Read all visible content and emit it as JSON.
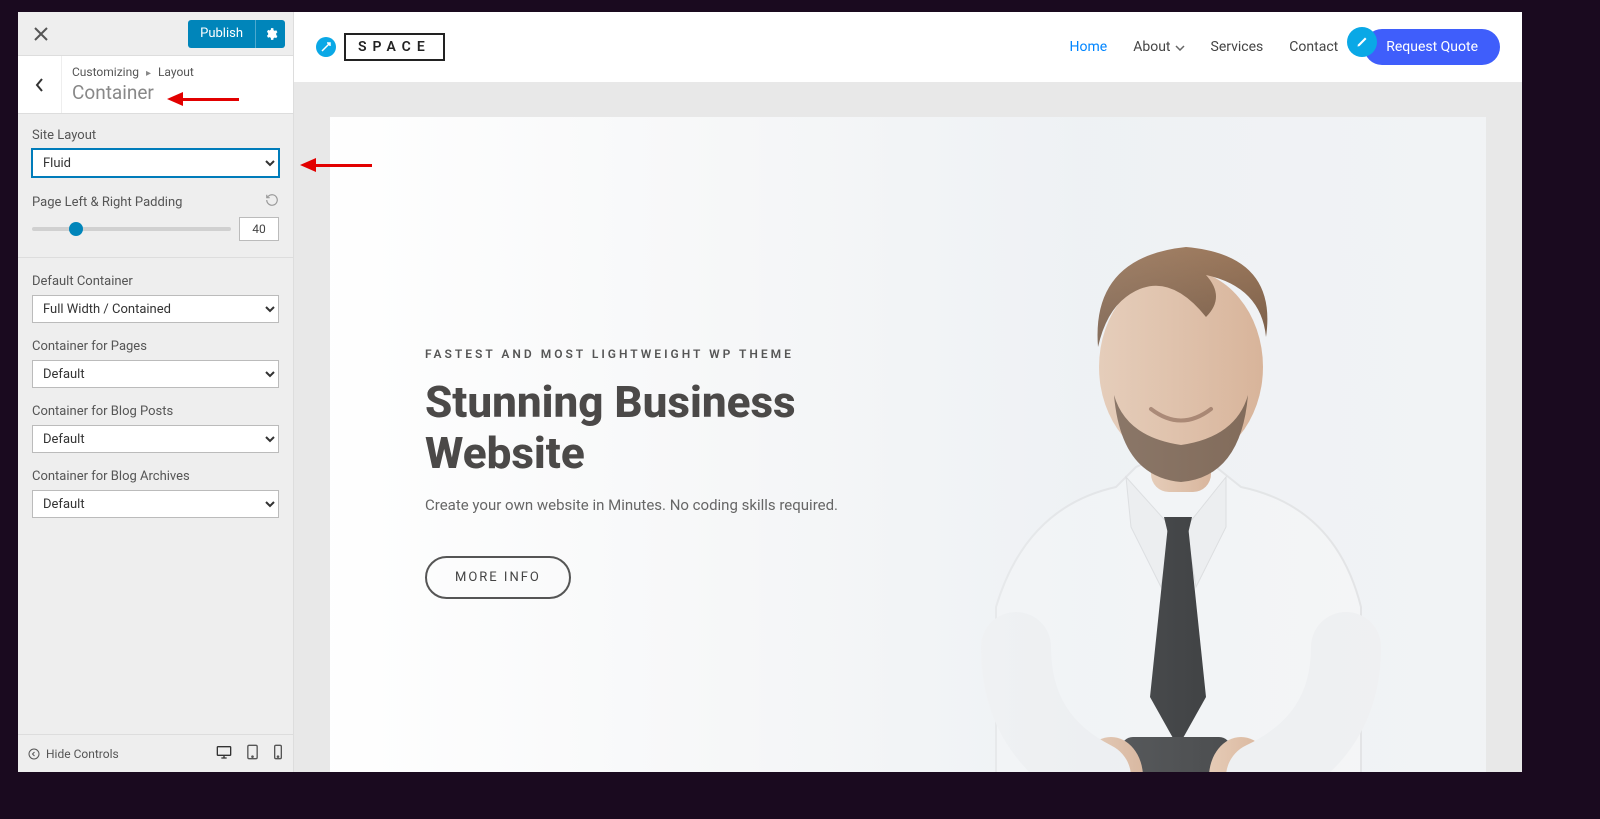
{
  "topbar": {
    "publish_label": "Publish"
  },
  "breadcrumb": {
    "root": "Customizing",
    "parent": "Layout",
    "title": "Container"
  },
  "fields": {
    "site_layout": {
      "label": "Site Layout",
      "value": "Fluid"
    },
    "padding": {
      "label": "Page Left & Right Padding",
      "value": "40"
    },
    "default_container": {
      "label": "Default Container",
      "value": "Full Width / Contained"
    },
    "pages": {
      "label": "Container for Pages",
      "value": "Default"
    },
    "posts": {
      "label": "Container for Blog Posts",
      "value": "Default"
    },
    "archives": {
      "label": "Container for Blog Archives",
      "value": "Default"
    }
  },
  "footer": {
    "hide_label": "Hide Controls"
  },
  "site": {
    "logo_text": "SPACE",
    "nav": {
      "home": "Home",
      "about": "About",
      "services": "Services",
      "contact": "Contact"
    },
    "quote_label": "Request Quote",
    "hero": {
      "eyebrow": "FASTEST AND MOST LIGHTWEIGHT WP THEME",
      "title_l1": "Stunning Business",
      "title_l2": "Website",
      "sub": "Create your own website in Minutes. No coding skills required.",
      "more_label": "MORE INFO"
    }
  }
}
